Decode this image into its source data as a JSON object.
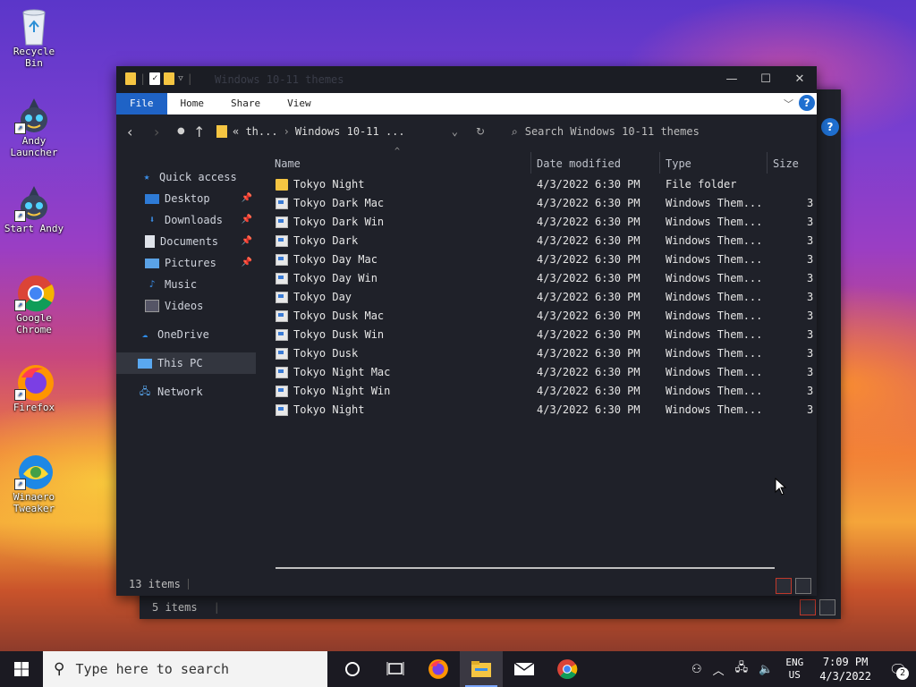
{
  "desktop": {
    "icons": [
      {
        "label": "Recycle Bin",
        "name": "recycle-bin"
      },
      {
        "label": "Andy Launcher",
        "name": "andy-launcher"
      },
      {
        "label": "Start Andy",
        "name": "start-andy"
      },
      {
        "label": "Google Chrome",
        "name": "google-chrome"
      },
      {
        "label": "Firefox",
        "name": "firefox"
      },
      {
        "label": "Winaero Tweaker",
        "name": "winaero-tweaker"
      }
    ]
  },
  "back_window": {
    "status": "5 items"
  },
  "window": {
    "title": "Windows 10-11 themes",
    "ribbon_tabs": [
      "File",
      "Home",
      "Share",
      "View"
    ],
    "address": {
      "crumb1": "« th...",
      "crumb2": "Windows 10-11 ..."
    },
    "search_placeholder": "Search Windows 10-11 themes",
    "sidebar": [
      {
        "label": "Quick access",
        "icon": "star-icon",
        "pinned": false
      },
      {
        "label": "Desktop",
        "icon": "desktop-icon",
        "pinned": true
      },
      {
        "label": "Downloads",
        "icon": "download-icon",
        "pinned": true
      },
      {
        "label": "Documents",
        "icon": "documents-icon",
        "pinned": true
      },
      {
        "label": "Pictures",
        "icon": "pictures-icon",
        "pinned": true
      },
      {
        "label": "Music",
        "icon": "music-icon",
        "pinned": false
      },
      {
        "label": "Videos",
        "icon": "videos-icon",
        "pinned": false
      },
      {
        "label": "OneDrive",
        "icon": "cloud-icon",
        "pinned": false
      },
      {
        "label": "This PC",
        "icon": "computer-icon",
        "pinned": false
      },
      {
        "label": "Network",
        "icon": "network-icon",
        "pinned": false
      }
    ],
    "columns": {
      "name": "Name",
      "date": "Date modified",
      "type": "Type",
      "size": "Size"
    },
    "files": [
      {
        "name": "Tokyo Night",
        "date": "4/3/2022 6:30 PM",
        "type": "File folder",
        "size": "",
        "kind": "folder"
      },
      {
        "name": "Tokyo Dark Mac",
        "date": "4/3/2022 6:30 PM",
        "type": "Windows Them...",
        "size": "3",
        "kind": "theme"
      },
      {
        "name": "Tokyo Dark Win",
        "date": "4/3/2022 6:30 PM",
        "type": "Windows Them...",
        "size": "3",
        "kind": "theme"
      },
      {
        "name": "Tokyo Dark",
        "date": "4/3/2022 6:30 PM",
        "type": "Windows Them...",
        "size": "3",
        "kind": "theme"
      },
      {
        "name": "Tokyo Day Mac",
        "date": "4/3/2022 6:30 PM",
        "type": "Windows Them...",
        "size": "3",
        "kind": "theme"
      },
      {
        "name": "Tokyo Day Win",
        "date": "4/3/2022 6:30 PM",
        "type": "Windows Them...",
        "size": "3",
        "kind": "theme"
      },
      {
        "name": "Tokyo Day",
        "date": "4/3/2022 6:30 PM",
        "type": "Windows Them...",
        "size": "3",
        "kind": "theme"
      },
      {
        "name": "Tokyo Dusk Mac",
        "date": "4/3/2022 6:30 PM",
        "type": "Windows Them...",
        "size": "3",
        "kind": "theme"
      },
      {
        "name": "Tokyo Dusk Win",
        "date": "4/3/2022 6:30 PM",
        "type": "Windows Them...",
        "size": "3",
        "kind": "theme"
      },
      {
        "name": "Tokyo Dusk",
        "date": "4/3/2022 6:30 PM",
        "type": "Windows Them...",
        "size": "3",
        "kind": "theme"
      },
      {
        "name": "Tokyo Night Mac",
        "date": "4/3/2022 6:30 PM",
        "type": "Windows Them...",
        "size": "3",
        "kind": "theme"
      },
      {
        "name": "Tokyo Night Win",
        "date": "4/3/2022 6:30 PM",
        "type": "Windows Them...",
        "size": "3",
        "kind": "theme"
      },
      {
        "name": "Tokyo Night",
        "date": "4/3/2022 6:30 PM",
        "type": "Windows Them...",
        "size": "3",
        "kind": "theme"
      }
    ],
    "status": "13 items"
  },
  "taskbar": {
    "search_placeholder": "Type here to search",
    "apps": [
      "cortana-icon",
      "task-view-icon",
      "firefox-icon",
      "file-explorer-icon",
      "mail-icon",
      "chrome-icon"
    ],
    "lang_top": "ENG",
    "lang_bottom": "US",
    "time": "7:09 PM",
    "date": "4/3/2022",
    "notification_count": "2"
  },
  "colors": {
    "explorer_bg": "#1f2129",
    "file_tab": "#1f63c6",
    "folder": "#f5c542",
    "taskbar": "#1b1a22"
  }
}
